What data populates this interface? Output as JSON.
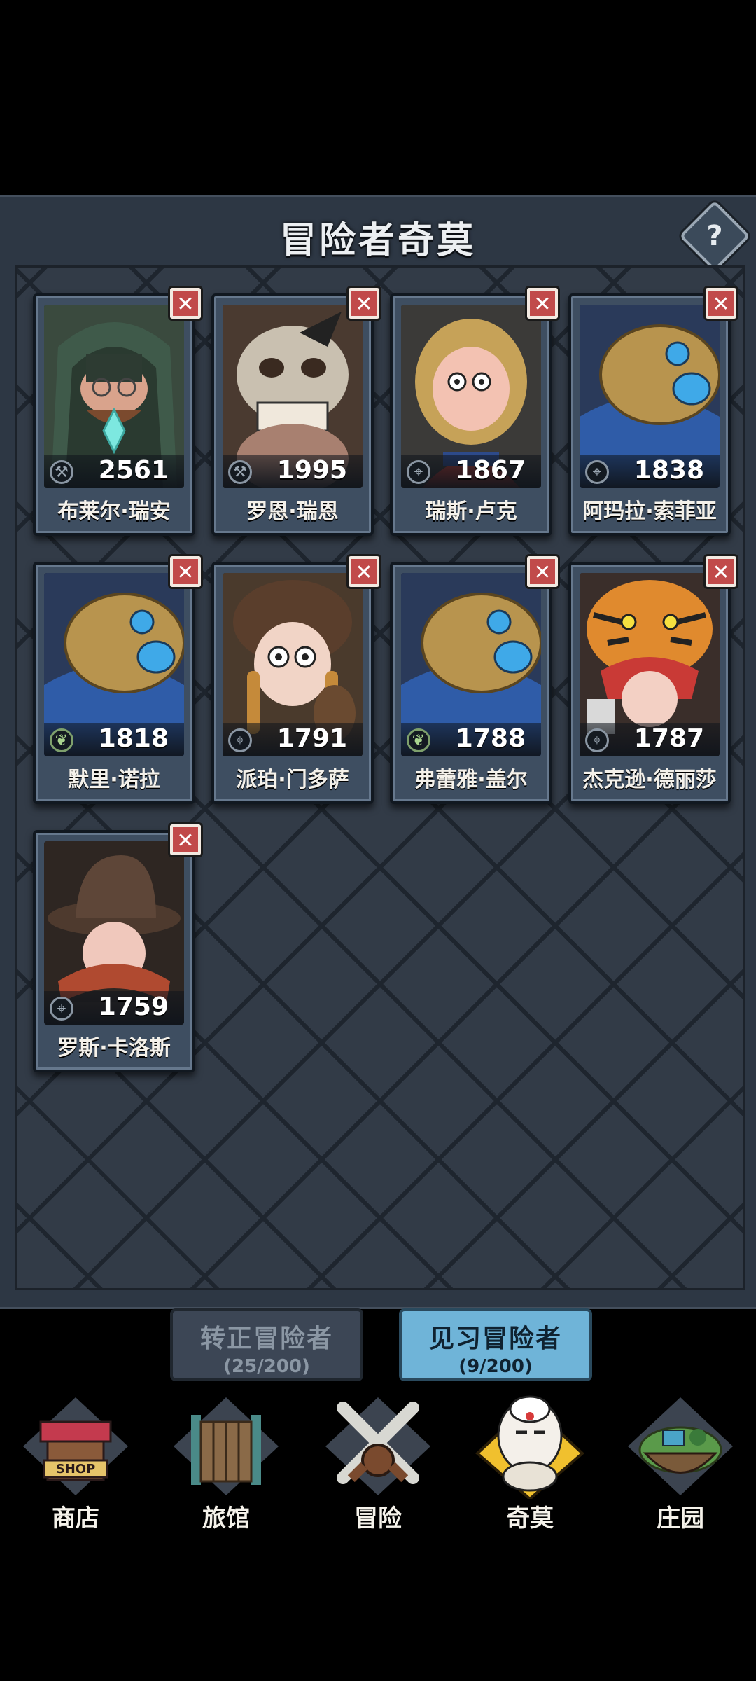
{
  "panel": {
    "title": "冒险者奇莫",
    "help_label": "?"
  },
  "cards": [
    {
      "score": "2561",
      "name": "布莱尔·瑞安",
      "class_icon": "green-pick-icon",
      "class_color": "gray",
      "portrait": "hooded-crystal"
    },
    {
      "score": "1995",
      "name": "罗恩·瑞恩",
      "class_icon": "pick-icon",
      "class_color": "gray",
      "portrait": "skull-helmet"
    },
    {
      "score": "1867",
      "name": "瑞斯·卢克",
      "class_icon": "target-icon",
      "class_color": "gray",
      "portrait": "blonde-girl"
    },
    {
      "score": "1838",
      "name": "阿玛拉·索菲亚",
      "class_icon": "target-icon",
      "class_color": "gray",
      "portrait": "bronze-helmet"
    },
    {
      "score": "1818",
      "name": "默里·诺拉",
      "class_icon": "leaf-icon",
      "class_color": "green",
      "portrait": "bronze-helmet"
    },
    {
      "score": "1791",
      "name": "派珀·门多萨",
      "class_icon": "target-icon",
      "class_color": "gray",
      "portrait": "bear-hood"
    },
    {
      "score": "1788",
      "name": "弗蕾雅·盖尔",
      "class_icon": "leaf-icon",
      "class_color": "green",
      "portrait": "bronze-helmet"
    },
    {
      "score": "1787",
      "name": "杰克逊·德丽莎",
      "class_icon": "target-icon",
      "class_color": "gray",
      "portrait": "tiger-hood"
    },
    {
      "score": "1759",
      "name": "罗斯·卡洛斯",
      "class_icon": "target-icon",
      "class_color": "gray",
      "portrait": "cowboy"
    }
  ],
  "tabs": [
    {
      "label": "转正冒险者",
      "count": "(25/200)",
      "active": false
    },
    {
      "label": "见习冒险者",
      "count": "(9/200)",
      "active": true
    }
  ],
  "nav": [
    {
      "label": "商店",
      "badge": "SHOP"
    },
    {
      "label": "旅馆"
    },
    {
      "label": "冒险"
    },
    {
      "label": "奇莫",
      "active": true
    },
    {
      "label": "庄园"
    }
  ],
  "colors": {
    "panel": "#2d3744",
    "close": "#c14a4a",
    "active_tab": "#6fb4d8",
    "nav_active": "#f0c02e"
  }
}
